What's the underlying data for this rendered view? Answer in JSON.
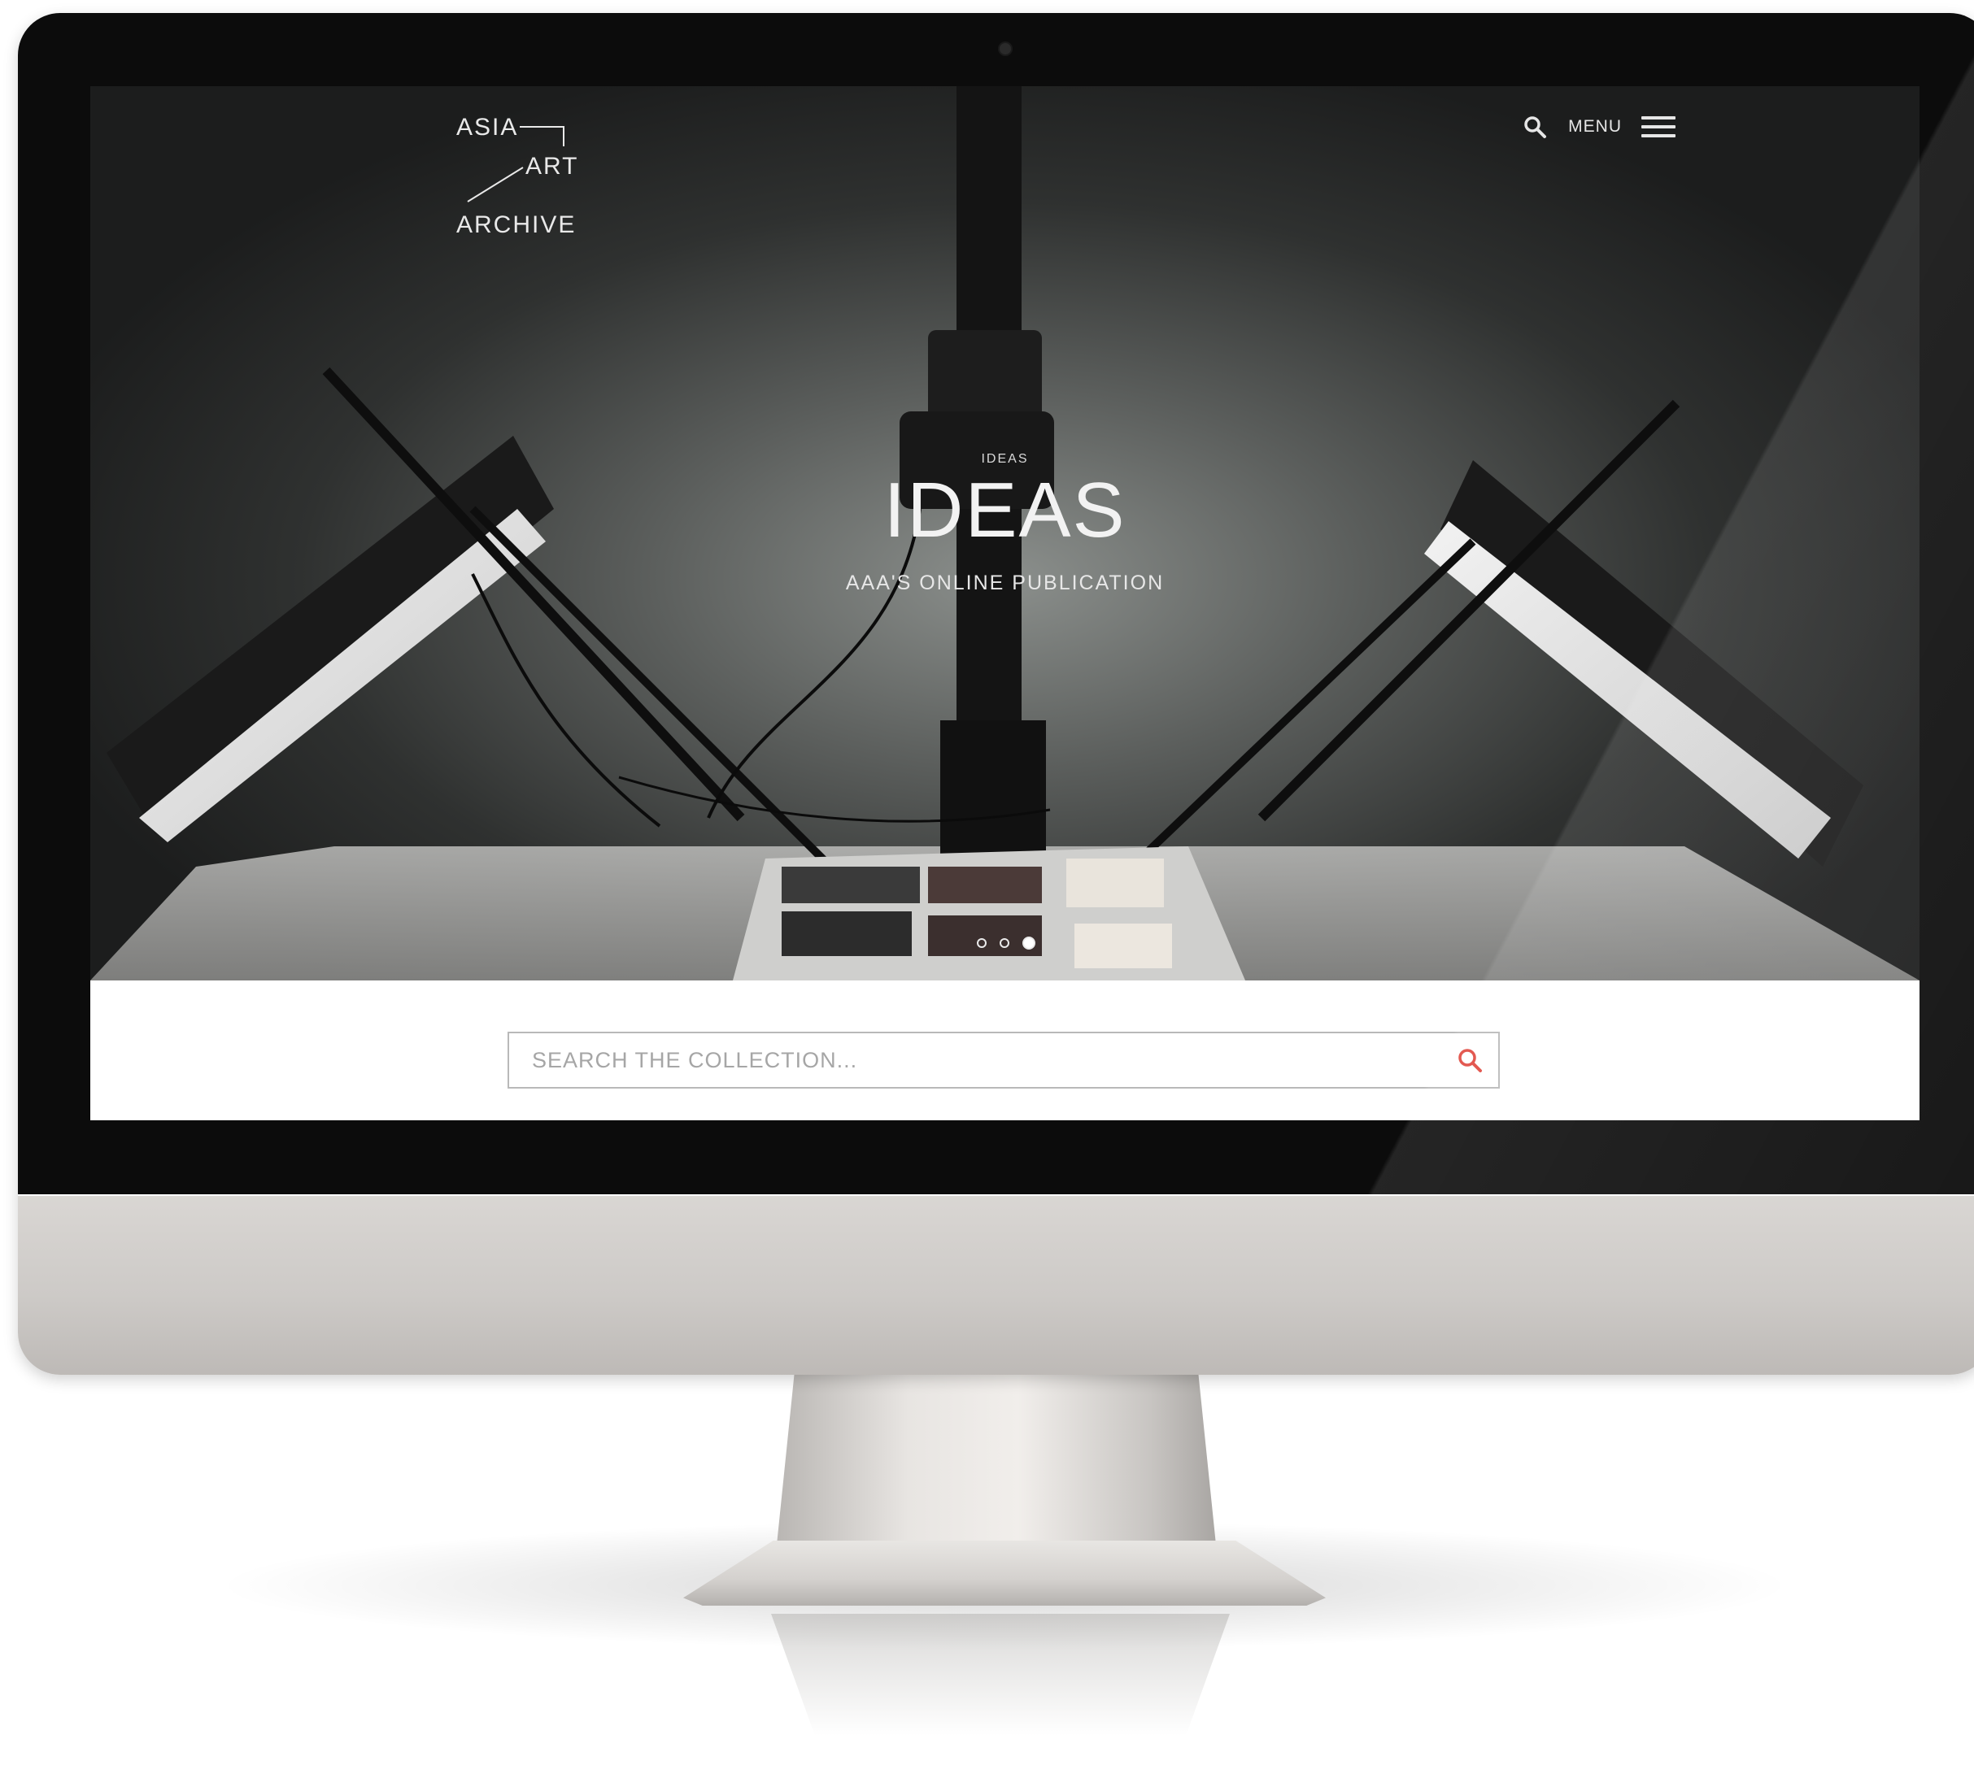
{
  "site": {
    "logo": {
      "line1": "ASIA",
      "line2": "ART",
      "line3": "ARCHIVE"
    },
    "nav": {
      "search_icon": "search-icon",
      "menu_label": "MENU",
      "menu_icon": "hamburger-icon"
    }
  },
  "hero": {
    "eyebrow": "IDEAS",
    "title": "IDEAS",
    "subtitle": "AAA'S ONLINE PUBLICATION",
    "slides": {
      "count": 3,
      "active": 3
    }
  },
  "search": {
    "placeholder": "SEARCH THE COLLECTION...",
    "icon": "search-icon",
    "icon_color": "#e0473e"
  }
}
